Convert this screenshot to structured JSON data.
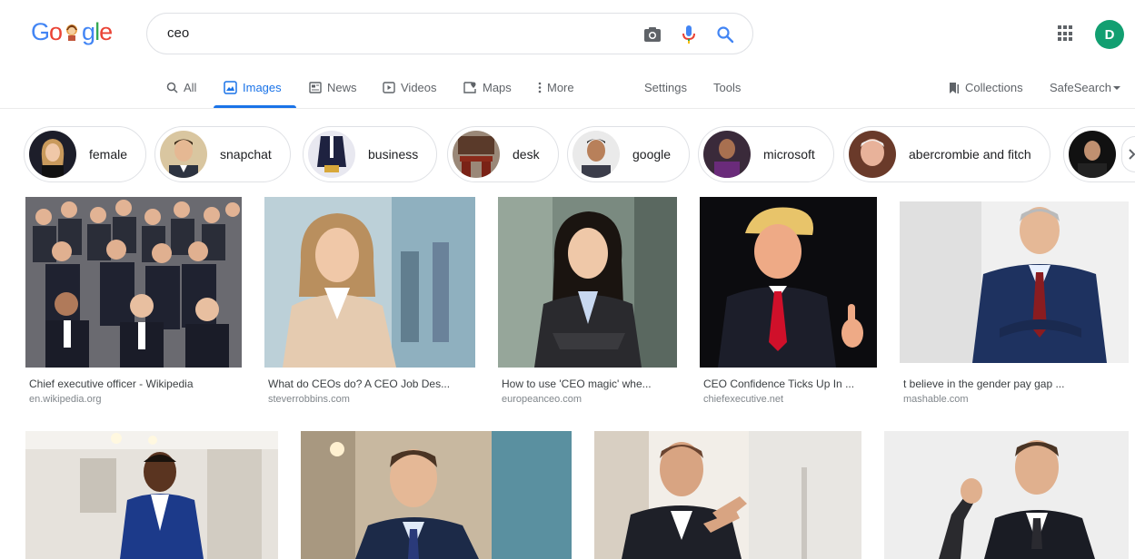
{
  "logo": {
    "alt": "Google",
    "letters": [
      "G",
      "o",
      "",
      "g",
      "l",
      "e"
    ]
  },
  "search": {
    "query": "ceo",
    "placeholder": ""
  },
  "header": {
    "avatar_letter": "D"
  },
  "tabs": [
    {
      "label": "All",
      "icon": "search-icon"
    },
    {
      "label": "Images",
      "icon": "image-icon",
      "active": true
    },
    {
      "label": "News",
      "icon": "news-icon"
    },
    {
      "label": "Videos",
      "icon": "video-icon"
    },
    {
      "label": "Maps",
      "icon": "map-icon"
    },
    {
      "label": "More",
      "icon": "more-vert-icon"
    }
  ],
  "tools": {
    "settings": "Settings",
    "tools": "Tools",
    "collections": "Collections",
    "safesearch": "SafeSearch"
  },
  "chips": [
    {
      "label": "female"
    },
    {
      "label": "snapchat"
    },
    {
      "label": "business"
    },
    {
      "label": "desk"
    },
    {
      "label": "google"
    },
    {
      "label": "microsoft"
    },
    {
      "label": "abercrombie and fitch"
    },
    {
      "label": ""
    }
  ],
  "results": [
    {
      "title": "Chief executive officer - Wikipedia",
      "source": "en.wikipedia.org"
    },
    {
      "title": "What do CEOs do? A CEO Job Des...",
      "source": "steverrobbins.com"
    },
    {
      "title": "How to use 'CEO magic' whe...",
      "source": "europeanceo.com"
    },
    {
      "title": "CEO Confidence Ticks Up In ...",
      "source": "chiefexecutive.net"
    },
    {
      "title": "t believe in the gender pay gap ...",
      "source": "mashable.com"
    },
    {
      "title": "",
      "source": ""
    },
    {
      "title": "",
      "source": ""
    },
    {
      "title": "",
      "source": ""
    },
    {
      "title": "",
      "source": ""
    }
  ],
  "colors": {
    "accent": "#1a73e8",
    "avatar": "#129f71",
    "g_blue": "#4285f4",
    "g_red": "#ea4335",
    "g_yellow": "#fbbc05",
    "g_green": "#34a853"
  }
}
